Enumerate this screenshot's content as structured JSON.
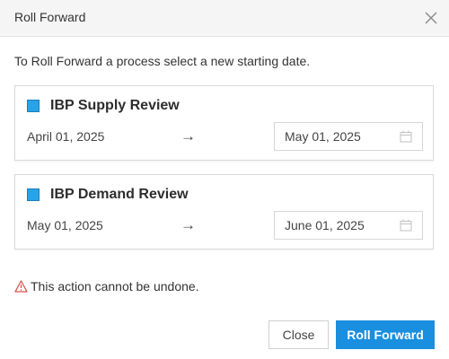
{
  "dialog": {
    "title": "Roll Forward",
    "instruction": "To Roll Forward a process select a new starting date."
  },
  "processes": [
    {
      "name": "IBP Supply Review",
      "current_date": "April 01, 2025",
      "arrow": "→",
      "new_date": "May 01, 2025"
    },
    {
      "name": "IBP Demand Review",
      "current_date": "May 01, 2025",
      "arrow": "→",
      "new_date": "June 01, 2025"
    }
  ],
  "warning": {
    "text": "This action cannot be undone.",
    "icon": "warning-triangle-icon",
    "color": "#d9534f"
  },
  "buttons": {
    "close_label": "Close",
    "primary_label": "Roll Forward"
  },
  "colors": {
    "accent": "#1a8fe0",
    "swatch": "#29a3e8"
  }
}
